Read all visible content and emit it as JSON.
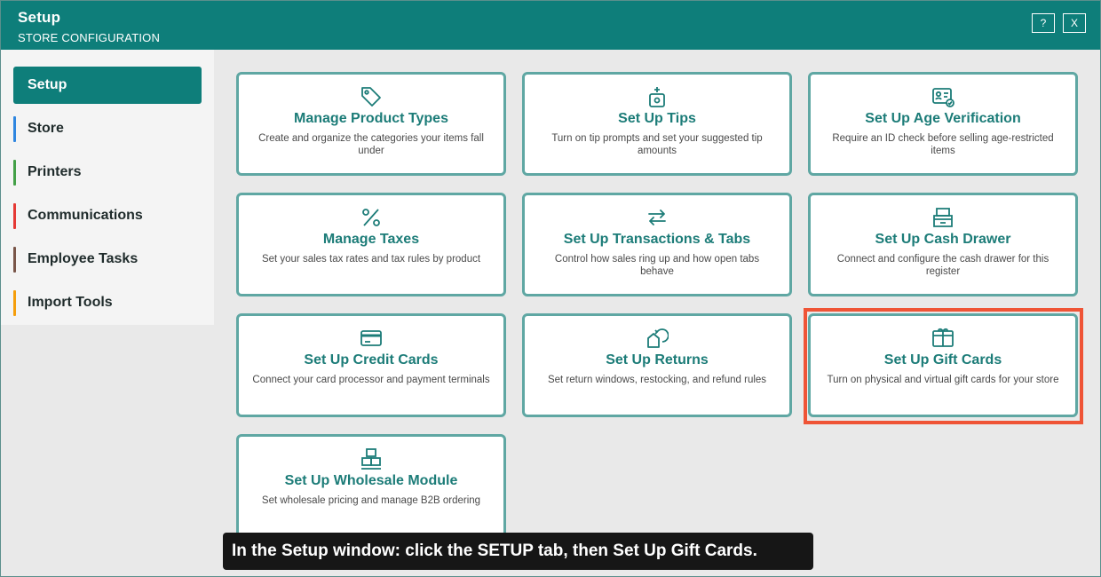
{
  "window": {
    "title": "Setup",
    "subtitle": "STORE CONFIGURATION",
    "help_label": "?",
    "close_label": "X"
  },
  "sidebar": {
    "items": [
      {
        "label": "Setup",
        "active": true,
        "color": "#0e7e7a"
      },
      {
        "label": "Store",
        "color": "#2f86e0"
      },
      {
        "label": "Printers",
        "color": "#43a047"
      },
      {
        "label": "Communications",
        "color": "#e53935"
      },
      {
        "label": "Employee Tasks",
        "color": "#795548"
      },
      {
        "label": "Import Tools",
        "color": "#f59e0b"
      }
    ]
  },
  "cards": [
    {
      "icon": "tag-icon",
      "title": "Manage Product Types",
      "desc": "Create and organize the categories your items fall under"
    },
    {
      "icon": "tip-jar-icon",
      "title": "Set Up Tips",
      "desc": "Turn on tip prompts and set your suggested tip amounts"
    },
    {
      "icon": "id-card-check-icon",
      "title": "Set Up Age Verification",
      "desc": "Require an ID check before selling age-restricted items"
    },
    {
      "icon": "percent-icon",
      "title": "Manage Taxes",
      "desc": "Set your sales tax rates and tax rules by product"
    },
    {
      "icon": "swap-arrows-icon",
      "title": "Set Up Transactions & Tabs",
      "desc": "Control how sales ring up and how open tabs behave"
    },
    {
      "icon": "cash-drawer-icon",
      "title": "Set Up Cash Drawer",
      "desc": "Connect and configure the cash drawer for this register"
    },
    {
      "icon": "credit-card-icon",
      "title": "Set Up Credit Cards",
      "desc": "Connect your card processor and payment terminals"
    },
    {
      "icon": "return-box-icon",
      "title": "Set Up Returns",
      "desc": "Set return windows, restocking, and refund rules"
    },
    {
      "icon": "gift-card-icon",
      "title": "Set Up Gift Cards",
      "desc": "Turn on physical and virtual gift cards for your store"
    },
    {
      "icon": "boxes-icon",
      "title": "Set Up Wholesale Module",
      "desc": "Set wholesale pricing and manage B2B ordering"
    }
  ],
  "instruction": "In the Setup window: click the SETUP tab, then Set Up Gift Cards.",
  "colors": {
    "accent": "#0e7e7a",
    "card_border": "#5fa7a3",
    "highlight": "#ef5436"
  }
}
